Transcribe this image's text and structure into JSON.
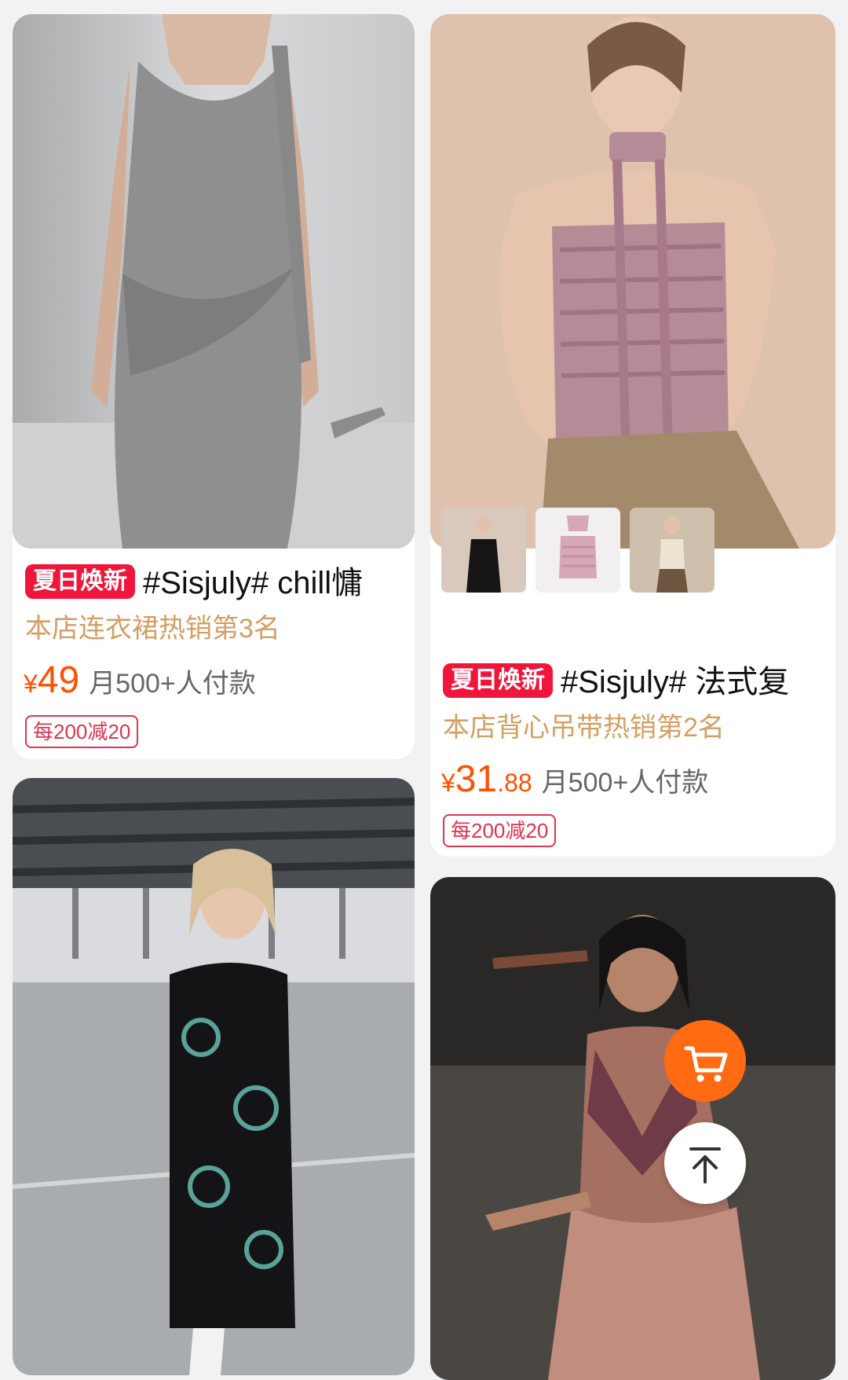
{
  "products": [
    {
      "promo_tag": "夏日焕新",
      "title": "#Sisjuly# chill慵",
      "rank": "本店连衣裙热销第3名",
      "currency": "¥",
      "price_int": "49",
      "price_dec": "",
      "sales": "月500+人付款",
      "coupon": "每200减20",
      "image_icon": "product-photo-grey-draped-dress"
    },
    {
      "promo_tag": "夏日焕新",
      "title": "#Sisjuly# 法式复",
      "rank": "本店背心吊带热销第2名",
      "currency": "¥",
      "price_int": "31",
      "price_dec": ".88",
      "sales": "月500+人付款",
      "coupon": "每200减20",
      "image_icon": "product-photo-pink-ruched-tube-top",
      "variant_thumbs": [
        "black-halter-variant",
        "pink-top-variant",
        "beige-top-variant"
      ]
    },
    {
      "image_icon": "product-photo-black-dragon-qipao-dress"
    },
    {
      "image_icon": "product-photo-printed-halter-maxi-dress"
    }
  ],
  "floating": {
    "cart_icon": "cart-icon",
    "top_icon": "back-to-top-icon"
  },
  "colors": {
    "accent": "#ff5000",
    "tag_red": "#f0163b",
    "rank_gold": "#d59e62",
    "coupon_red": "#e0334f"
  }
}
